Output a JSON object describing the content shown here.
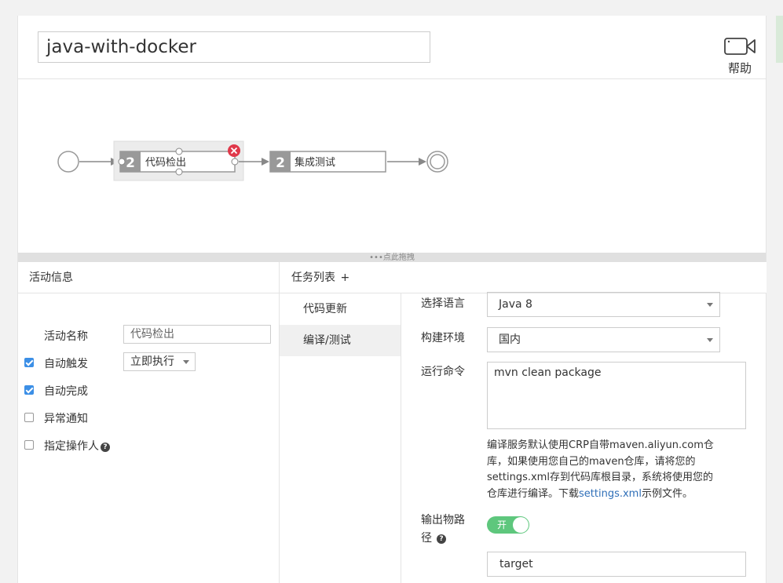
{
  "pipeline": {
    "name": "java-with-docker"
  },
  "help": {
    "label": "帮助",
    "icon": "video-camera-icon"
  },
  "flow": {
    "nodes": [
      {
        "number": "2",
        "label": "代码检出",
        "selected": true
      },
      {
        "number": "2",
        "label": "集成测试",
        "selected": false
      }
    ],
    "drag_hint": "•••点此拖拽",
    "delete_icon": "close-circle-icon"
  },
  "activity": {
    "title": "活动信息",
    "name_label": "活动名称",
    "name_value": "代码检出",
    "auto_trigger_label": "自动触发",
    "auto_trigger_checked": true,
    "auto_trigger_value": "立即执行",
    "auto_complete_label": "自动完成",
    "auto_complete_checked": true,
    "exception_notify_label": "异常通知",
    "exception_notify_checked": false,
    "assign_operator_label": "指定操作人",
    "assign_operator_checked": false
  },
  "tasks": {
    "title": "任务列表",
    "add_symbol": "+",
    "items": [
      {
        "label": "代码更新",
        "active": false
      },
      {
        "label": "编译/测试",
        "active": true
      }
    ]
  },
  "build": {
    "language_label": "选择语言",
    "language_value": "Java 8",
    "env_label": "构建环境",
    "env_value": "国内",
    "command_label": "运行命令",
    "command_value": "mvn clean package",
    "help_text_1": "编译服务默认使用CRP自带maven.aliyun.com仓库，如果使用您自己的maven仓库，请将您的settings.xml存到代码库根目录，系统将使用您的仓库进行编译。下载",
    "help_link": "settings.xml",
    "help_text_2": "示例文件。",
    "output_label_1": "输出物路",
    "output_label_2": "径",
    "output_toggle": "开",
    "output_toggle_on": true,
    "output_value": "target"
  },
  "colors": {
    "accent": "#3c8fe6",
    "toggle_on": "#5ec77d",
    "link": "#2f6fb8",
    "delete": "#e0384a"
  }
}
